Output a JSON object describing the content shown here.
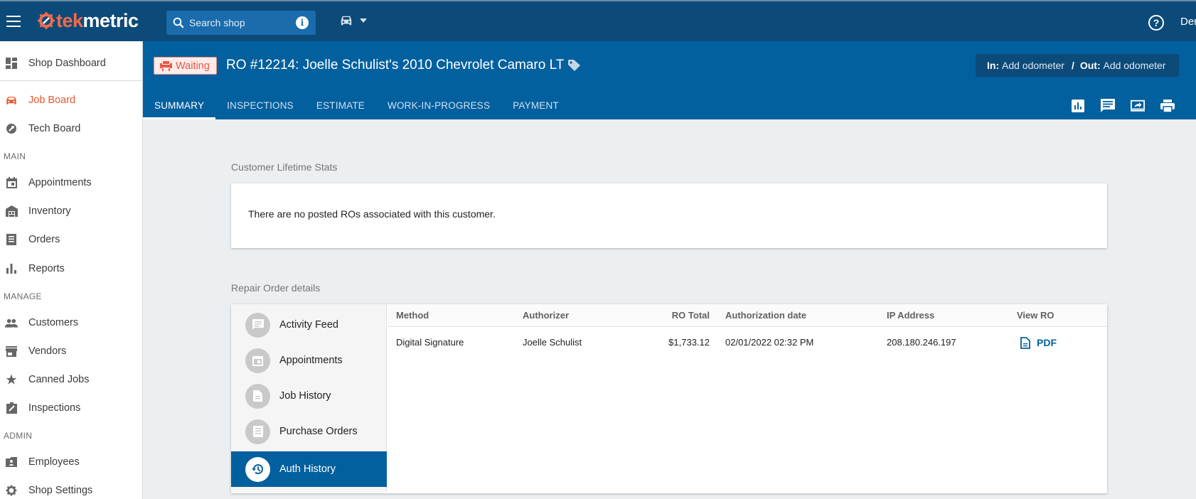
{
  "brand": {
    "logo_prefix": "tek",
    "logo_suffix": "metric"
  },
  "topbar": {
    "search_placeholder": "Search shop",
    "user_name": "Der"
  },
  "sidebar": {
    "top_items": [
      {
        "label": "Shop Dashboard",
        "icon": "dashboard-icon"
      }
    ],
    "board_items": [
      {
        "label": "Job Board",
        "icon": "car-icon",
        "active": true
      },
      {
        "label": "Tech Board",
        "icon": "wrench-icon"
      }
    ],
    "sections": [
      {
        "title": "MAIN",
        "items": [
          {
            "label": "Appointments",
            "icon": "calendar-icon"
          },
          {
            "label": "Inventory",
            "icon": "warehouse-icon"
          },
          {
            "label": "Orders",
            "icon": "list-icon"
          },
          {
            "label": "Reports",
            "icon": "bar-chart-icon"
          }
        ]
      },
      {
        "title": "MANAGE",
        "items": [
          {
            "label": "Customers",
            "icon": "people-icon"
          },
          {
            "label": "Vendors",
            "icon": "store-icon"
          },
          {
            "label": "Canned Jobs",
            "icon": "star-icon"
          },
          {
            "label": "Inspections",
            "icon": "clipboard-icon"
          }
        ]
      },
      {
        "title": "ADMIN",
        "items": [
          {
            "label": "Employees",
            "icon": "badge-icon"
          },
          {
            "label": "Shop Settings",
            "icon": "gear-icon"
          }
        ]
      }
    ]
  },
  "header": {
    "status_badge": "Waiting",
    "ro_title": "RO #12214: Joelle Schulist's 2010 Chevrolet Camaro LT",
    "odometer": {
      "in_label": "In:",
      "in_value": "Add odometer",
      "sep": "/",
      "out_label": "Out:",
      "out_value": "Add odometer"
    },
    "tabs": [
      "SUMMARY",
      "INSPECTIONS",
      "ESTIMATE",
      "WORK-IN-PROGRESS",
      "PAYMENT"
    ],
    "active_tab": "SUMMARY"
  },
  "stats": {
    "label": "Customer Lifetime Stats",
    "empty_message": "There are no posted ROs associated with this customer."
  },
  "details": {
    "label": "Repair Order details",
    "menu": [
      {
        "label": "Activity Feed",
        "icon": "comment-icon"
      },
      {
        "label": "Appointments",
        "icon": "calendar-icon"
      },
      {
        "label": "Job History",
        "icon": "document-icon"
      },
      {
        "label": "Purchase Orders",
        "icon": "list-icon"
      },
      {
        "label": "Auth History",
        "icon": "history-icon",
        "active": true
      }
    ],
    "auth_table": {
      "headers": [
        "Method",
        "Authorizer",
        "RO Total",
        "Authorization date",
        "IP Address",
        "View RO"
      ],
      "rows": [
        {
          "method": "Digital Signature",
          "authorizer": "Joelle Schulist",
          "ro_total": "$1,733.12",
          "date": "02/01/2022 02:32 PM",
          "ip": "208.180.246.197",
          "view": "PDF"
        }
      ]
    }
  },
  "colors": {
    "header_blue": "#03609e",
    "topbar_blue": "#0c4a79",
    "accent_orange": "#e8582f",
    "waiting_red": "#e8584a"
  }
}
